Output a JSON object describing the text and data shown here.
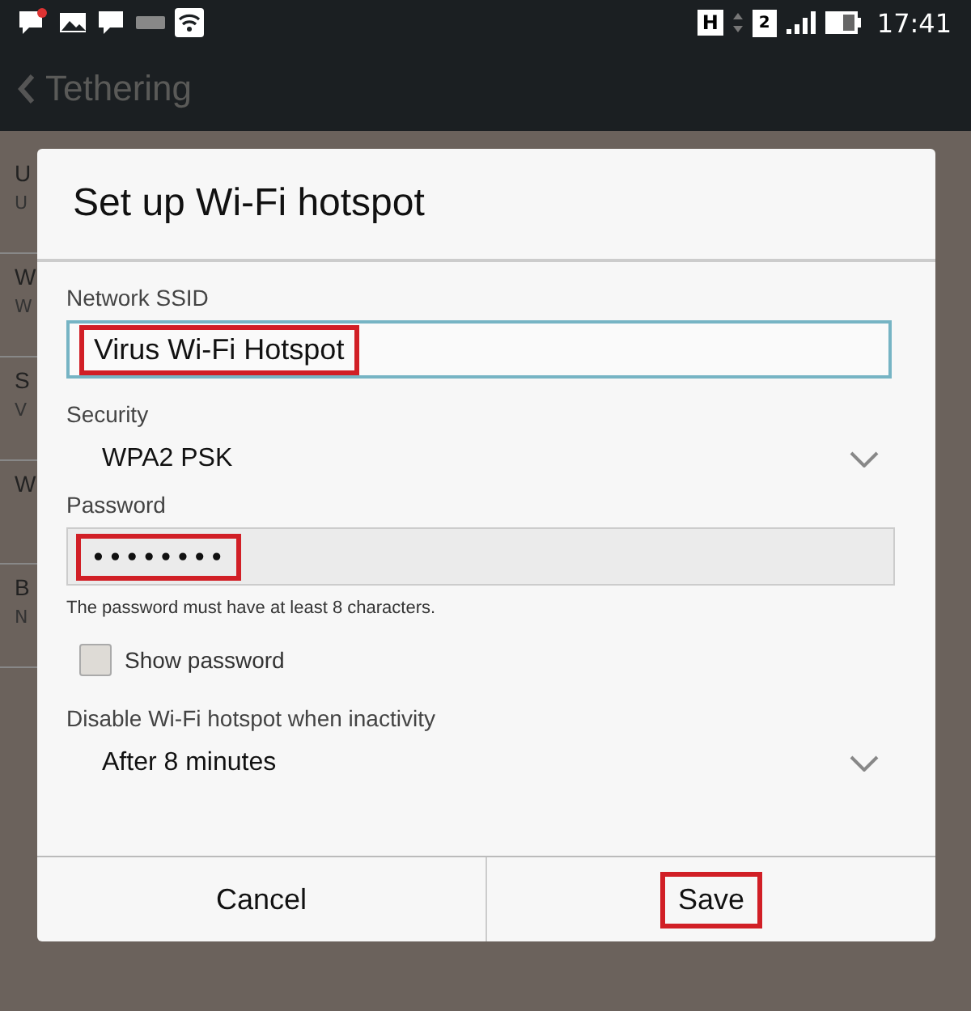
{
  "status_bar": {
    "network_type": "H",
    "sim_slot": "2",
    "time": "17:41"
  },
  "action_bar": {
    "title": "Tethering"
  },
  "background_list": [
    {
      "title": "U",
      "subtitle": "U"
    },
    {
      "title": "W",
      "subtitle": "W"
    },
    {
      "title": "S",
      "subtitle": "V"
    },
    {
      "title": "W"
    },
    {
      "title": "B",
      "subtitle": "N"
    }
  ],
  "dialog": {
    "title": "Set up Wi-Fi hotspot",
    "ssid": {
      "label": "Network SSID",
      "value": "Virus Wi-Fi Hotspot",
      "highlighted": true
    },
    "security": {
      "label": "Security",
      "value": "WPA2 PSK"
    },
    "password": {
      "label": "Password",
      "value": "••••••••",
      "highlighted": true,
      "hint": "The password must have at least 8 characters."
    },
    "show_password": {
      "label": "Show password",
      "checked": false
    },
    "timeout": {
      "label": "Disable Wi-Fi hotspot when inactivity",
      "value": "After 8 minutes"
    },
    "buttons": [
      {
        "label": "Cancel",
        "highlighted": false
      },
      {
        "label": "Save",
        "highlighted": true
      }
    ]
  }
}
